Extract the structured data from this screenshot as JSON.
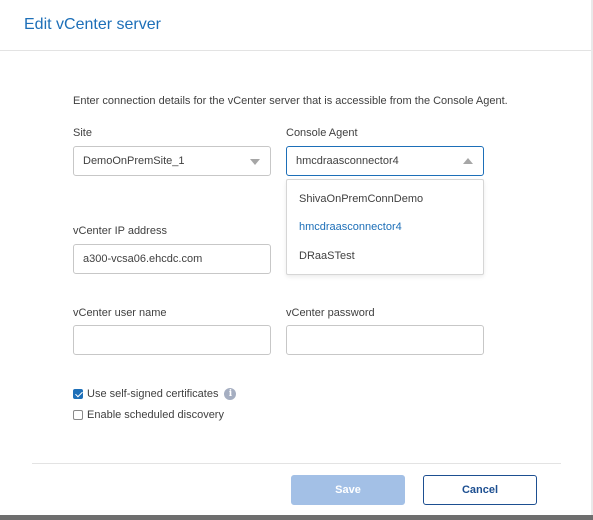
{
  "dialog": {
    "title": "Edit vCenter server",
    "intro": "Enter connection details for the vCenter server that is accessible from the Console Agent."
  },
  "site": {
    "label": "Site",
    "value": "DemoOnPremSite_1"
  },
  "console_agent": {
    "label": "Console Agent",
    "value": "hmcdraasconnector4",
    "options": [
      "ShivaOnPremConnDemo",
      "hmcdraasconnector4",
      "DRaaSTest"
    ],
    "selected_index": 1
  },
  "vcenter_ip": {
    "label": "vCenter IP address",
    "value": "a300-vcsa06.ehcdc.com"
  },
  "vcenter_user": {
    "label": "vCenter user name",
    "value": ""
  },
  "vcenter_password": {
    "label": "vCenter password",
    "value": ""
  },
  "options": {
    "self_signed": {
      "label": "Use self-signed certificates",
      "checked": true
    },
    "scheduled_discovery": {
      "label": "Enable scheduled discovery",
      "checked": false
    }
  },
  "footer": {
    "save_label": "Save",
    "cancel_label": "Cancel"
  },
  "colors": {
    "accent": "#1d6fb8",
    "save_disabled": "#a3c0e6",
    "cancel_border": "#1d4f91"
  }
}
